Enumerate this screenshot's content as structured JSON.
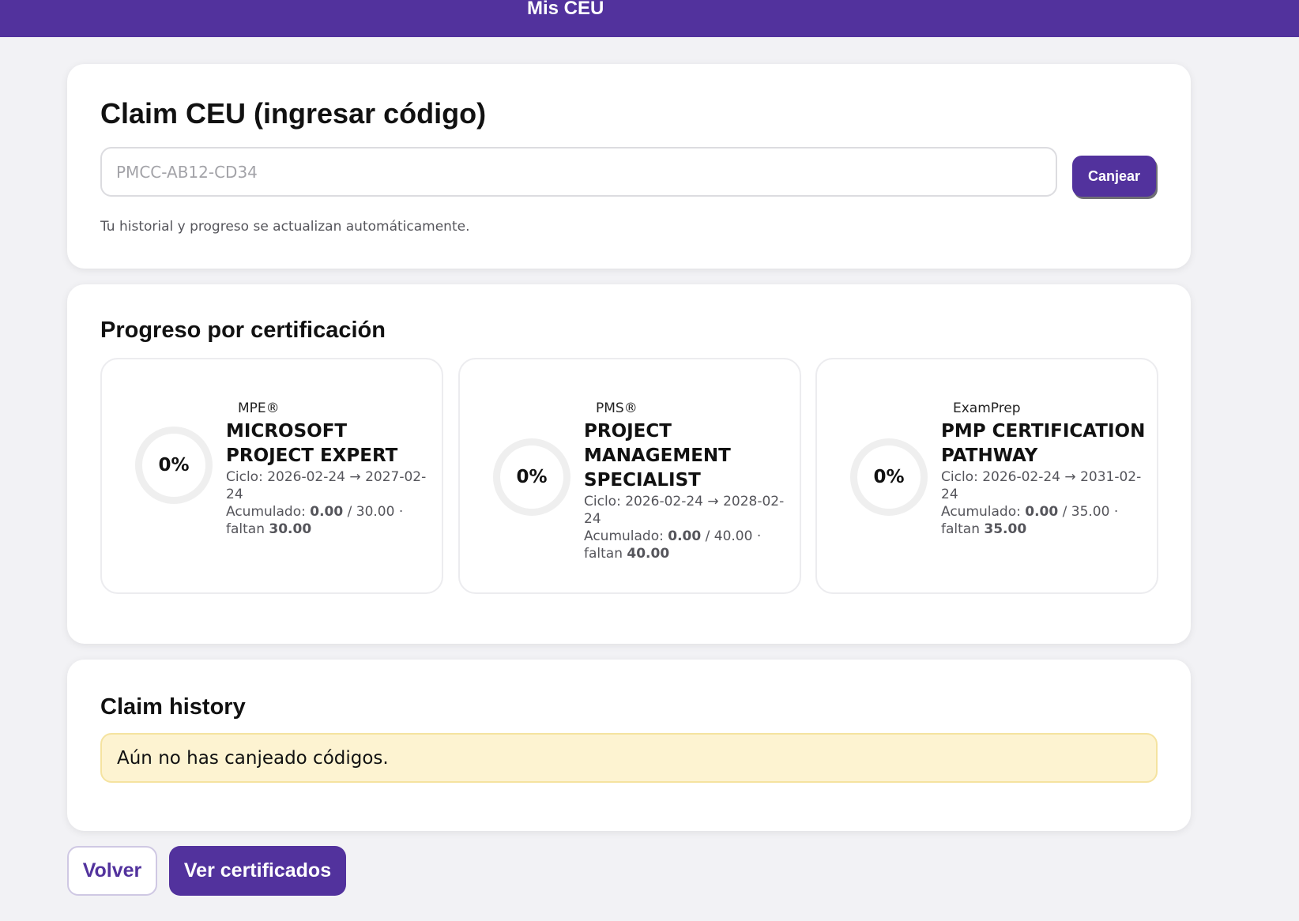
{
  "header": {
    "title": "Mis CEU"
  },
  "claim": {
    "title": "Claim CEU (ingresar código)",
    "input_placeholder": "PMCC-AB12-CD34",
    "input_value": "",
    "redeem_label": "Canjear",
    "hint": "Tu historial y progreso se actualizan automáticamente."
  },
  "progress": {
    "title": "Progreso por certificación",
    "certs": [
      {
        "percent_label": "0%",
        "progress_fraction": 0,
        "code": "MPE®",
        "name": "MICROSOFT PROJECT EXPERT",
        "cycle_prefix": "Ciclo: ",
        "cycle_start": "2026-02-24",
        "cycle_arrow": " → ",
        "cycle_end": "2027-02-24",
        "accum_label": "Acumulado: ",
        "accum_value": "0.00",
        "accum_sep": " / ",
        "accum_total": "30.00",
        "dot": " · ",
        "remaining_label": "faltan ",
        "remaining_value": "30.00"
      },
      {
        "percent_label": "0%",
        "progress_fraction": 0,
        "code": "PMS®",
        "name": "PROJECT MANAGEMENT SPECIALIST",
        "cycle_prefix": "Ciclo: ",
        "cycle_start": "2026-02-24",
        "cycle_arrow": " → ",
        "cycle_end": "2028-02-24",
        "accum_label": "Acumulado: ",
        "accum_value": "0.00",
        "accum_sep": " / ",
        "accum_total": "40.00",
        "dot": " · ",
        "remaining_label": "faltan ",
        "remaining_value": "40.00"
      },
      {
        "percent_label": "0%",
        "progress_fraction": 0,
        "code": "ExamPrep",
        "name": "PMP CERTIFICATION PATHWAY",
        "cycle_prefix": "Ciclo: ",
        "cycle_start": "2026-02-24",
        "cycle_arrow": " → ",
        "cycle_end": "2031-02-24",
        "accum_label": "Acumulado: ",
        "accum_value": "0.00",
        "accum_sep": " / ",
        "accum_total": "35.00",
        "dot": " · ",
        "remaining_label": "faltan ",
        "remaining_value": "35.00"
      }
    ]
  },
  "history": {
    "title": "Claim history",
    "empty_message": "Aún no has canjeado códigos."
  },
  "footer": {
    "back_label": "Volver",
    "certificates_label": "Ver certificados"
  },
  "colors": {
    "brand": "#52329d",
    "alert_background": "#fdf3d1",
    "alert_border": "#f5e3a0"
  }
}
